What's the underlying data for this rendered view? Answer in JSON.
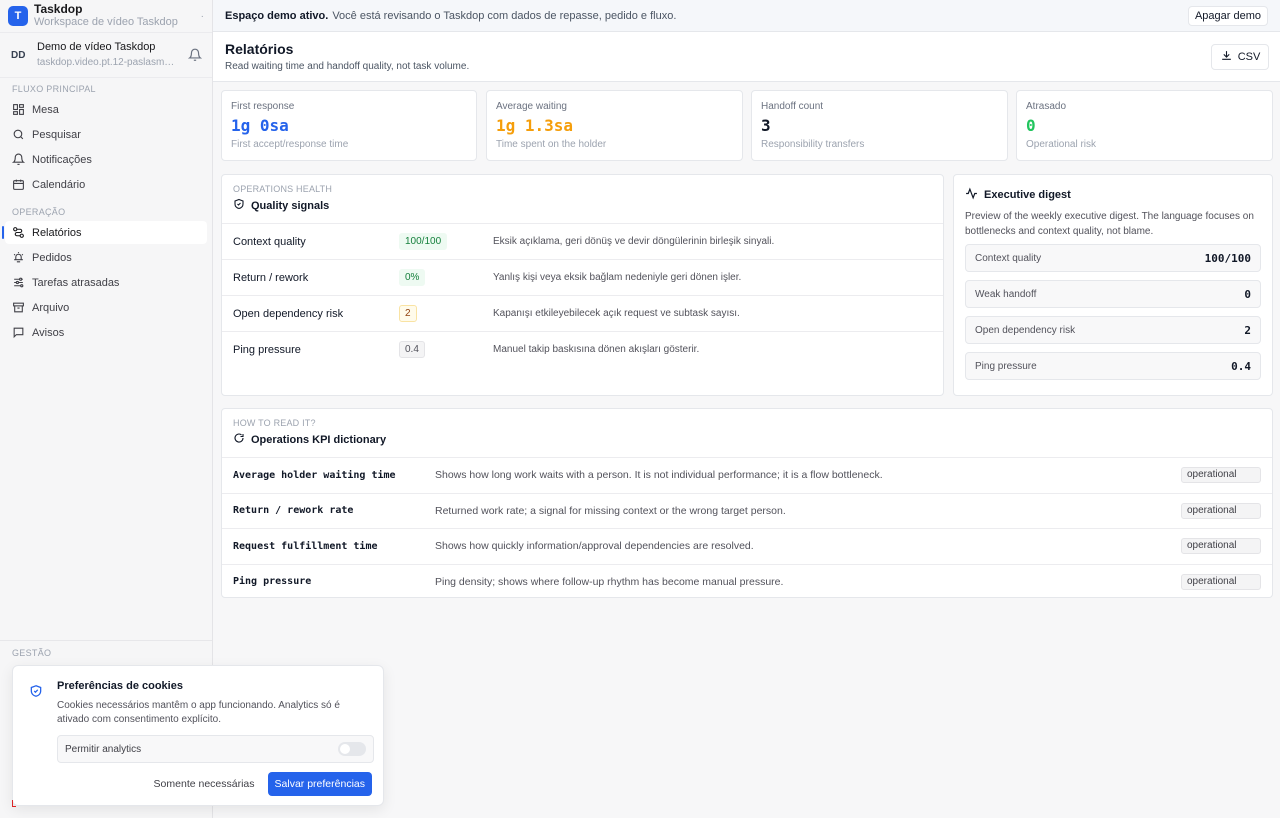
{
  "workspace": {
    "logo_letter": "T",
    "name": "Taskdop",
    "subtitle": "Workspace de vídeo Taskdop"
  },
  "user": {
    "initials": "DD",
    "name": "Demo de vídeo Taskdop",
    "email": "taskdop.video.pt.12-paslasma..."
  },
  "sidebar": {
    "section_main": "FLUXO PRINCIPAL",
    "main_items": [
      {
        "label": "Mesa",
        "icon": "grid-icon"
      },
      {
        "label": "Pesquisar",
        "icon": "search-icon"
      },
      {
        "label": "Notificações",
        "icon": "bell-icon"
      },
      {
        "label": "Calendário",
        "icon": "calendar-icon"
      }
    ],
    "section_ops": "OPERAÇÃO",
    "ops_items": [
      {
        "label": "Relatórios",
        "icon": "route-icon",
        "active": true
      },
      {
        "label": "Pedidos",
        "icon": "bell-ring-icon"
      },
      {
        "label": "Tarefas atrasadas",
        "icon": "sliders-icon"
      },
      {
        "label": "Arquivo",
        "icon": "archive-icon"
      },
      {
        "label": "Avisos",
        "icon": "message-icon"
      }
    ],
    "section_manage": "GESTÃO"
  },
  "demo_bar": {
    "bold": "Espaço demo ativo.",
    "text": "Você está revisando o Taskdop com dados de repasse, pedido e fluxo.",
    "button": "Apagar demo"
  },
  "page": {
    "title": "Relatórios",
    "subtitle": "Read waiting time and handoff quality, not task volume.",
    "csv_button": "CSV"
  },
  "kpis": [
    {
      "label": "First response",
      "value": "1g 0sa",
      "sub": "First accept/response time",
      "color": "#2563eb"
    },
    {
      "label": "Average waiting",
      "value": "1g 1.3sa",
      "sub": "Time spent on the holder",
      "color": "#f59e0b"
    },
    {
      "label": "Handoff count",
      "value": "3",
      "sub": "Responsibility transfers",
      "color": "#111827"
    },
    {
      "label": "Atrasado",
      "value": "0",
      "sub": "Operational risk",
      "color": "#22c55e"
    }
  ],
  "quality": {
    "eyebrow": "OPERATIONS HEALTH",
    "title": "Quality signals",
    "rows": [
      {
        "name": "Context quality",
        "value": "100/100",
        "tone": "green",
        "desc": "Eksik açıklama, geri dönüş ve devir döngülerinin birleşik sinyali."
      },
      {
        "name": "Return / rework",
        "value": "0%",
        "tone": "green",
        "desc": "Yanlış kişi veya eksik bağlam nedeniyle geri dönen işler."
      },
      {
        "name": "Open dependency risk",
        "value": "2",
        "tone": "yellow",
        "desc": "Kapanışı etkileyebilecek açık request ve subtask sayısı."
      },
      {
        "name": "Ping pressure",
        "value": "0.4",
        "tone": "gray",
        "desc": "Manuel takip baskısına dönen akışları gösterir."
      }
    ]
  },
  "digest": {
    "title": "Executive digest",
    "text": "Preview of the weekly executive digest. The language focuses on bottlenecks and context quality, not blame.",
    "rows": [
      {
        "label": "Context quality",
        "value": "100/100"
      },
      {
        "label": "Weak handoff",
        "value": "0"
      },
      {
        "label": "Open dependency risk",
        "value": "2"
      },
      {
        "label": "Ping pressure",
        "value": "0.4"
      }
    ]
  },
  "dictionary": {
    "eyebrow": "HOW TO READ IT?",
    "title": "Operations KPI dictionary",
    "rows": [
      {
        "name": "Average holder waiting time",
        "desc": "Shows how long work waits with a person. It is not individual performance; it is a flow bottleneck.",
        "tag": "operational"
      },
      {
        "name": "Return / rework rate",
        "desc": "Returned work rate; a signal for missing context or the wrong target person.",
        "tag": "operational"
      },
      {
        "name": "Request fulfillment time",
        "desc": "Shows how quickly information/approval dependencies are resolved.",
        "tag": "operational"
      },
      {
        "name": "Ping pressure",
        "desc": "Ping density; shows where follow-up rhythm has become manual pressure.",
        "tag": "operational"
      }
    ]
  },
  "cookie": {
    "title": "Preferências de cookies",
    "text": "Cookies necessários mantêm o app funcionando. Analytics só é ativado com consentimento explícito.",
    "toggle_label": "Permitir analytics",
    "toggle_on": false,
    "secondary": "Somente necessárias",
    "primary": "Salvar preferências"
  }
}
